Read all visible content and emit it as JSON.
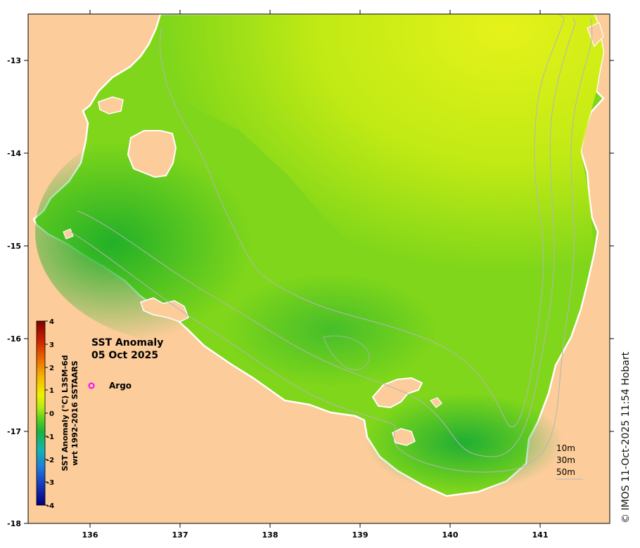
{
  "map": {
    "title_line1": "SST Anomaly",
    "title_line2": "05 Oct 2025",
    "argo_label": "Argo",
    "x_ticks": [
      "136",
      "137",
      "138",
      "139",
      "140",
      "141"
    ],
    "y_ticks": [
      "-13",
      "-14",
      "-15",
      "-16",
      "-17",
      "-18"
    ],
    "colorbar": {
      "label_line1": "SST Anomaly (°C) L3SM-6d",
      "label_line2": "wrt 1992-2016 SSTAARS",
      "ticks": [
        "4",
        "3",
        "2",
        "1",
        "0",
        "-1",
        "-2",
        "-3",
        "-4"
      ]
    },
    "depth_legend": [
      "10m",
      "30m",
      "50m"
    ],
    "credit": "© IMOS 11-Oct-2025 11:54 Hobart",
    "colors": {
      "land": "#fccc9a",
      "sea_cool": "#2bb82b",
      "sea_neutral": "#88d818",
      "sea_warm": "#d6f01a",
      "argo": "#ff00ff"
    }
  }
}
